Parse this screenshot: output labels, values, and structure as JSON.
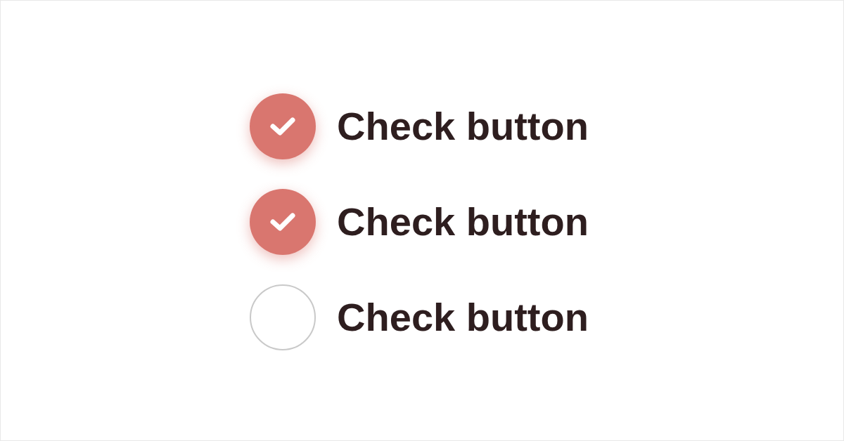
{
  "options": [
    {
      "label": "Check button",
      "checked": true
    },
    {
      "label": "Check button",
      "checked": true
    },
    {
      "label": "Check button",
      "checked": false
    }
  ]
}
